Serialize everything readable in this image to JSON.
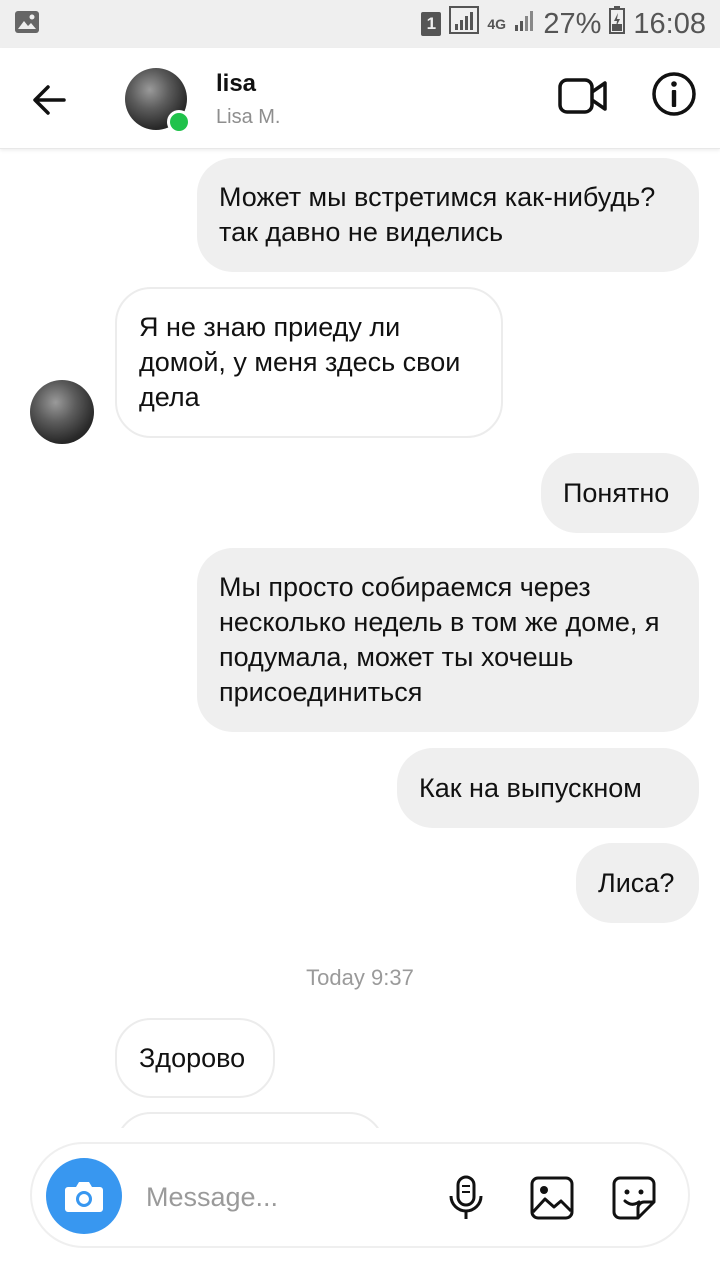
{
  "status_bar": {
    "sim": "1",
    "network": "4G",
    "battery": "27%",
    "time": "16:08"
  },
  "header": {
    "name": "lisa",
    "subtitle": "Lisa M."
  },
  "messages": [
    {
      "dir": "out",
      "text": "Может мы встретимся как-нибудь? так давно не виделись"
    },
    {
      "dir": "in",
      "text": "Я не знаю приеду ли домой, у меня здесь свои дела"
    },
    {
      "dir": "out",
      "text": "Понятно"
    },
    {
      "dir": "out",
      "text": "Мы просто собираемся через несколько недель в том же доме, я подумала, может ты хочешь присоединиться"
    },
    {
      "dir": "out",
      "text": "Как на выпускном"
    },
    {
      "dir": "out",
      "text": "Лиса?"
    },
    {
      "dir": "in",
      "text": "Здорово"
    }
  ],
  "time_separator": "Today 9:37",
  "composer": {
    "placeholder": "Message..."
  },
  "colors": {
    "accent": "#3897f0",
    "online": "#20c24b",
    "outgoing_bubble": "#efefef"
  }
}
